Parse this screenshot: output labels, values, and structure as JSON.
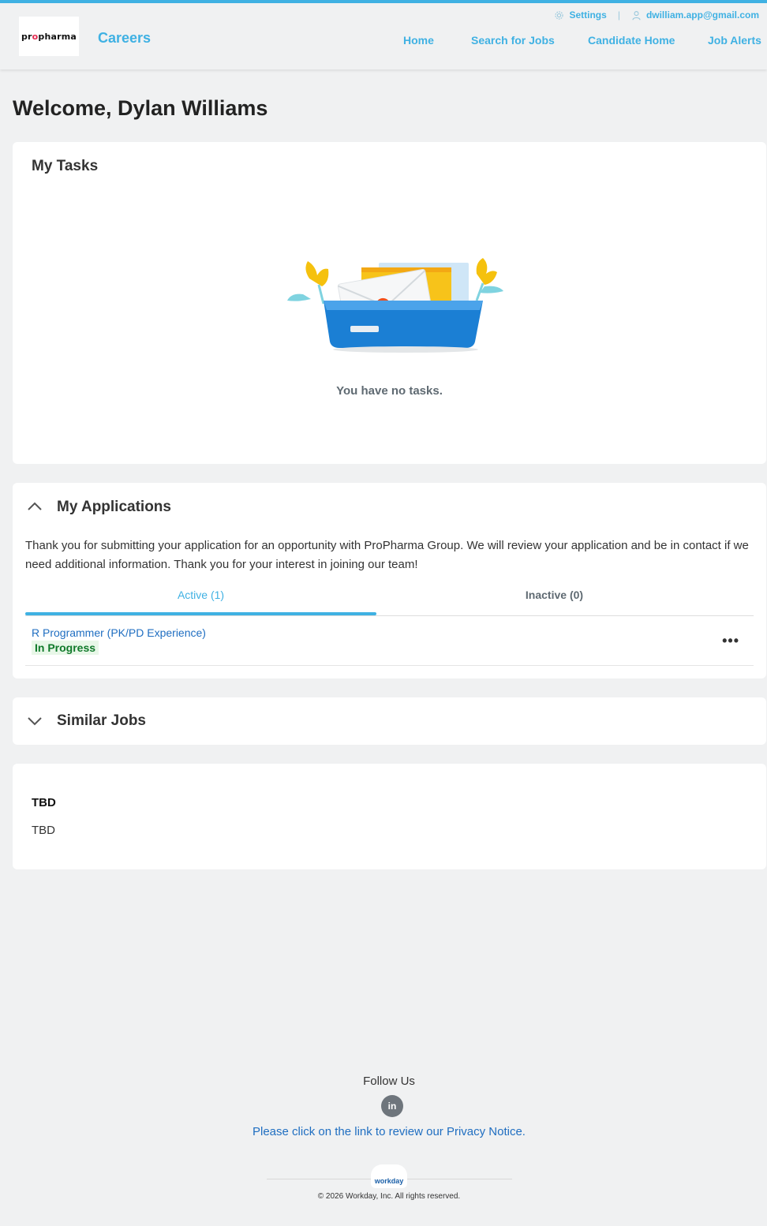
{
  "header": {
    "logo_text_pre": "pr",
    "logo_text_o": "o",
    "logo_text_post": "pharma",
    "brand": "Careers",
    "settings_label": "Settings",
    "user_email": "dwilliam.app@gmail.com",
    "nav": [
      "Home",
      "Search for Jobs",
      "Candidate Home",
      "Job Alerts"
    ]
  },
  "welcome": "Welcome, Dylan Williams",
  "tasks": {
    "title": "My Tasks",
    "empty_message": "You have no tasks."
  },
  "applications": {
    "title": "My Applications",
    "message": "Thank you for submitting your application for an opportunity with ProPharma Group. We will review your application and be in contact if we need additional information. Thank you for your interest in joining our team!",
    "tab_active": "Active (1)",
    "tab_inactive": "Inactive (0)",
    "items": [
      {
        "title": "R Programmer (PK/PD Experience)",
        "status": "In Progress"
      }
    ],
    "more_label": "•••"
  },
  "similar_jobs": {
    "title": "Similar Jobs"
  },
  "info_card": {
    "heading": "TBD",
    "body": "TBD"
  },
  "footer": {
    "follow_us": "Follow Us",
    "linkedin_label": "in",
    "privacy_link": "Please click on the link to review our Privacy Notice.",
    "workday_logo": "workday",
    "copyright": "© 2026 Workday, Inc. All rights reserved."
  },
  "colors": {
    "accent": "#3fb1e3",
    "link": "#1f6ec1",
    "status_green": "#117a2b",
    "background": "#f0f1f2"
  },
  "icons": [
    "gear-icon",
    "user-icon",
    "chevron-up-icon",
    "chevron-down-icon",
    "linkedin-icon",
    "inbox-tray-illustration"
  ]
}
